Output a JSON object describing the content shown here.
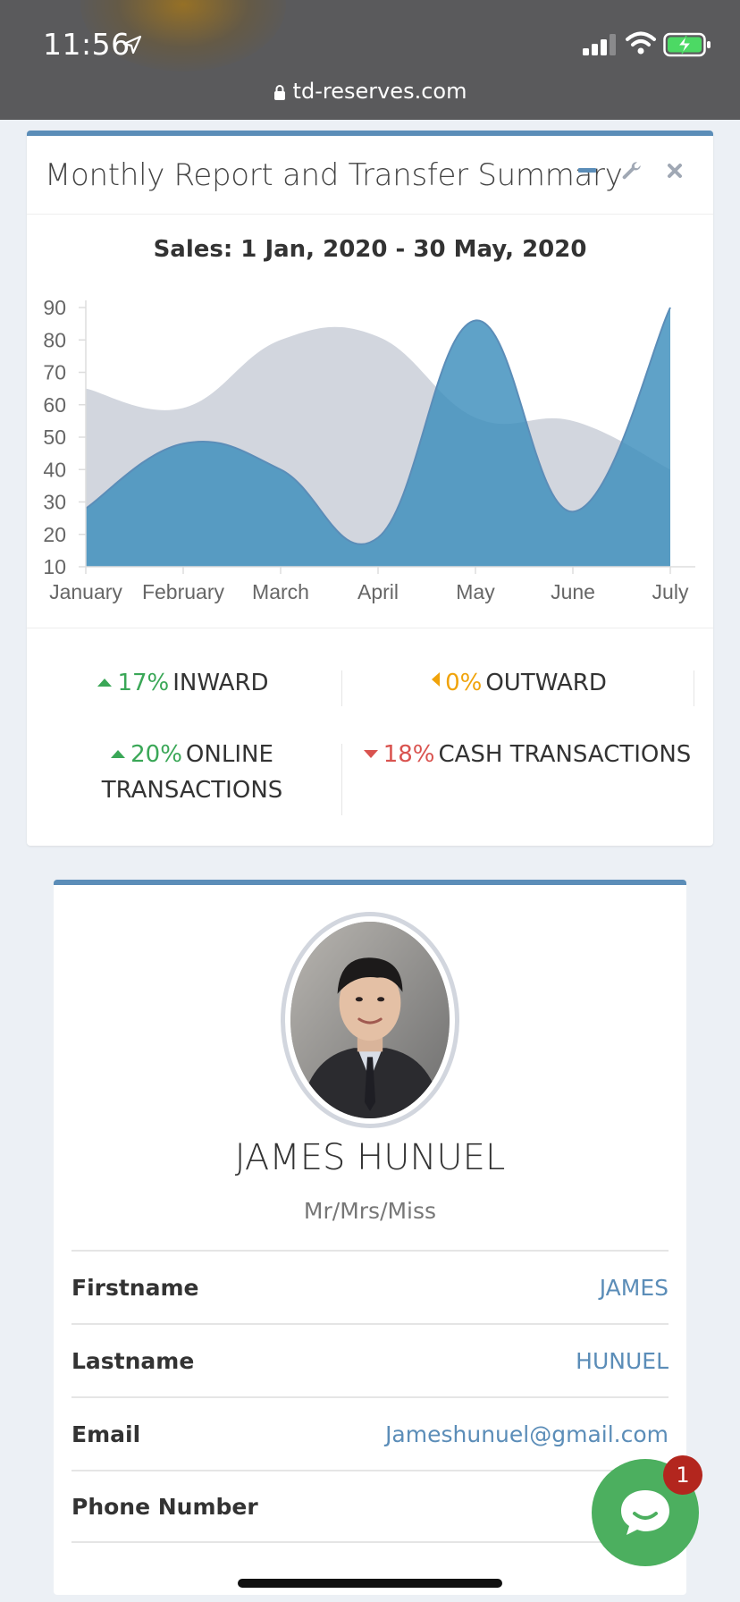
{
  "status_bar": {
    "time": "11:56",
    "url": "td-reserves.com"
  },
  "report_card": {
    "title": "Monthly Report and Transfer Summary",
    "tools": [
      "minus-icon",
      "wrench-icon",
      "close-icon"
    ],
    "chart_title": "Sales: 1 Jan, 2020 - 30 May, 2020",
    "stats": [
      {
        "arrow": "up",
        "pct": "17%",
        "label": "INWARD",
        "color": "#3aa757"
      },
      {
        "arrow": "left",
        "pct": "0%",
        "label": "OUTWARD",
        "color": "#f0a30a"
      },
      {
        "arrow": "up",
        "pct": "20%",
        "label": "ONLINE TRANSACTIONS",
        "color": "#3aa757"
      },
      {
        "arrow": "down",
        "pct": "18%",
        "label": "CASH TRANSACTIONS",
        "color": "#d9534f"
      }
    ]
  },
  "chart_data": {
    "type": "area",
    "title": "Sales: 1 Jan, 2020 - 30 May, 2020",
    "categories": [
      "January",
      "February",
      "March",
      "April",
      "May",
      "June",
      "July"
    ],
    "ylim": [
      10,
      90
    ],
    "yticks": [
      10,
      20,
      30,
      40,
      50,
      60,
      70,
      80,
      90
    ],
    "grid": false,
    "series": [
      {
        "values": [
          65,
          59,
          80,
          81,
          56,
          55,
          40
        ],
        "color": "#d2d6de"
      },
      {
        "values": [
          28,
          48,
          40,
          19,
          86,
          27,
          90
        ],
        "color": "#3c8dbc"
      }
    ]
  },
  "profile": {
    "name": "JAMES HUNUEL",
    "subtitle": "Mr/Mrs/Miss",
    "rows": [
      {
        "label": "Firstname",
        "value": "JAMES"
      },
      {
        "label": "Lastname",
        "value": "HUNUEL"
      },
      {
        "label": "Email",
        "value": "Jameshunuel@gmail.com"
      },
      {
        "label": "Phone Number",
        "value": ""
      }
    ]
  },
  "chat": {
    "badge": "1"
  },
  "colors": {
    "accent": "#5b8db8",
    "chat": "#4caf5f",
    "badge": "#b3261e"
  }
}
